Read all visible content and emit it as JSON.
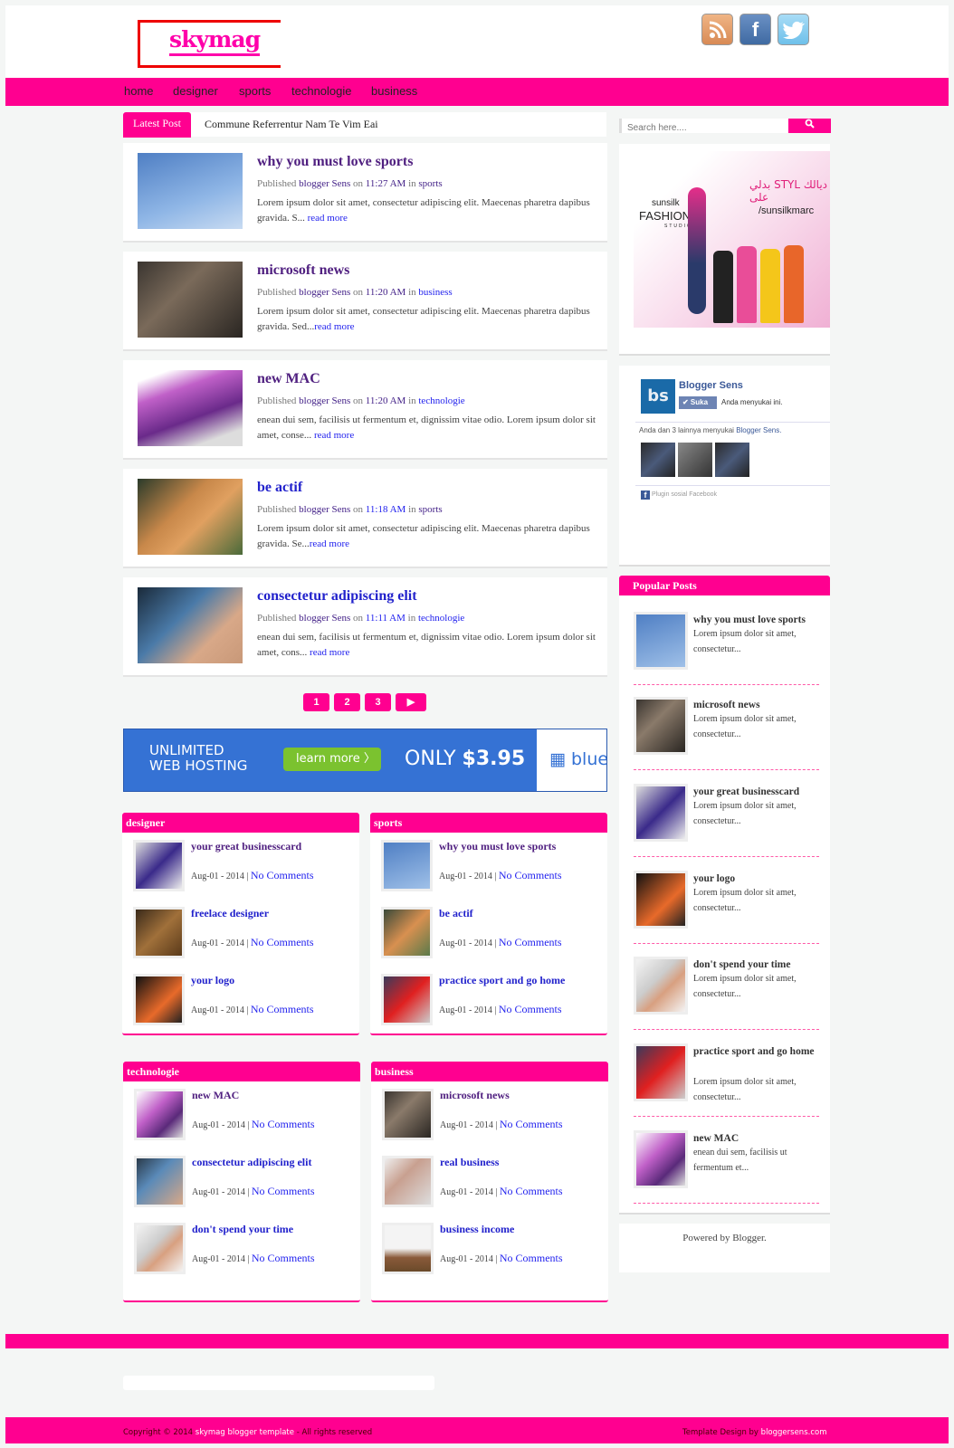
{
  "site": {
    "logo": "skymag"
  },
  "social": [
    {
      "name": "rss-icon",
      "glyph": "◉",
      "color": "#e8a06a"
    },
    {
      "name": "facebook-icon",
      "glyph": "f",
      "color": "#4a72a8"
    },
    {
      "name": "twitter-icon",
      "glyph": "🐦",
      "color": "#7cc8ee"
    }
  ],
  "nav": [
    "home",
    "designer",
    "sports",
    "technologie",
    "business"
  ],
  "latest": {
    "label": "Latest Post",
    "text": "Commune Referrentur Nam Te Vim Eai"
  },
  "search": {
    "placeholder": "Search here....",
    "button_icon": "search-icon"
  },
  "posts": [
    {
      "title": "why you must love sports",
      "published": "Published",
      "author": "blogger Sens",
      "on": "on",
      "time": "11:27 AM",
      "in": "in",
      "category": "sports",
      "excerpt": "Lorem ipsum dolor sit amet, consectetur adipiscing elit. Maecenas pharetra dapibus gravida. S...",
      "read_more": "read more"
    },
    {
      "title": "microsoft news",
      "published": "Published",
      "author": "blogger Sens",
      "on": "on",
      "time": "11:20 AM",
      "in": "in",
      "category": "business",
      "excerpt": "Lorem ipsum dolor sit amet, consectetur adipiscing elit. Maecenas pharetra dapibus gravida. Sed...",
      "read_more": "read more"
    },
    {
      "title": "new MAC",
      "published": "Published",
      "author": "blogger Sens",
      "on": "on",
      "time": "11:20 AM",
      "in": "in",
      "category": "technologie",
      "excerpt": "enean dui sem, facilisis ut fermentum et, dignissim vitae odio. Lorem ipsum dolor sit amet, conse...",
      "read_more": "read more"
    },
    {
      "title": "be actif",
      "published": "Published",
      "author": "blogger Sens",
      "on": "on",
      "time": "11:18 AM",
      "in": "in",
      "category": "sports",
      "excerpt": "Lorem ipsum dolor sit amet, consectetur adipiscing elit. Maecenas pharetra dapibus gravida. Se...",
      "read_more": "read more"
    },
    {
      "title": "consectetur adipiscing elit",
      "published": "Published",
      "author": "blogger Sens",
      "on": "on",
      "time": "11:11 AM",
      "in": "in",
      "category": "technologie",
      "excerpt": "enean dui sem, facilisis ut fermentum et, dignissim vitae odio. Lorem ipsum dolor sit amet, cons...",
      "read_more": "read more"
    }
  ],
  "pagination": [
    "1",
    "2",
    "3",
    "▶"
  ],
  "ad": {
    "line1": "UNLIMITED",
    "line2": "WEB HOSTING",
    "button": "learn more  〉",
    "price_prefix": "ONLY ",
    "price": "$3.95",
    "brand": "▦ bluehost"
  },
  "categories": [
    {
      "name": "designer",
      "items": [
        {
          "title": "your great businesscard",
          "date": "Aug-01 - 2014",
          "comments": "No Comments"
        },
        {
          "title": "freelace designer",
          "date": "Aug-01 - 2014",
          "comments": "No Comments"
        },
        {
          "title": "your logo",
          "date": "Aug-01 - 2014",
          "comments": "No Comments"
        }
      ]
    },
    {
      "name": "sports",
      "items": [
        {
          "title": "why you must love sports",
          "date": "Aug-01 - 2014",
          "comments": "No Comments"
        },
        {
          "title": "be actif",
          "date": "Aug-01 - 2014",
          "comments": "No Comments"
        },
        {
          "title": "practice sport and go home",
          "date": "Aug-01 - 2014",
          "comments": "No Comments"
        }
      ]
    },
    {
      "name": "technologie",
      "items": [
        {
          "title": "new MAC",
          "date": "Aug-01 - 2014",
          "comments": "No Comments"
        },
        {
          "title": "consectetur adipiscing elit",
          "date": "Aug-01 - 2014",
          "comments": "No Comments"
        },
        {
          "title": "don't spend your time",
          "date": "Aug-01 - 2014",
          "comments": "No Comments"
        }
      ]
    },
    {
      "name": "business",
      "items": [
        {
          "title": "microsoft news",
          "date": "Aug-01 - 2014",
          "comments": "No Comments"
        },
        {
          "title": "real business",
          "date": "Aug-01 - 2014",
          "comments": "No Comments"
        },
        {
          "title": "business income",
          "date": "Aug-01 - 2014",
          "comments": "No Comments"
        }
      ]
    }
  ],
  "sidebar_ad": {
    "brand": "sunsilk",
    "title": "FASHION",
    "sub": "STUDIO",
    "arabic": "بدلي STYL ديالك على",
    "handle": "/sunsilkmarc"
  },
  "facebook": {
    "page": "Blogger Sens",
    "avatar": "bs",
    "like": "✔ Suka",
    "liked_text": "Anda menyukai ini.",
    "count_prefix": "Anda dan 3 lainnya menyukai ",
    "count_page": "Blogger Sens.",
    "plugin": "Plugin sosial Facebook"
  },
  "popular": {
    "title": "Popular Posts",
    "items": [
      {
        "title": "why you must love sports",
        "excerpt": "Lorem ipsum dolor sit amet, consectetur..."
      },
      {
        "title": "microsoft news",
        "excerpt": "Lorem ipsum dolor sit amet, consectetur..."
      },
      {
        "title": "your great businesscard",
        "excerpt": "Lorem ipsum dolor sit amet, consectetur..."
      },
      {
        "title": "your logo",
        "excerpt": "Lorem ipsum dolor sit amet, consectetur..."
      },
      {
        "title": "don't spend your time",
        "excerpt": "Lorem ipsum dolor sit amet, consectetur..."
      },
      {
        "title": "practice sport and go home",
        "excerpt": "Lorem ipsum dolor sit amet, consectetur..."
      },
      {
        "title": "new MAC",
        "excerpt": "enean dui sem, facilisis ut fermentum et..."
      }
    ]
  },
  "powered": "Powered by Blogger.",
  "footer": {
    "copy_prefix": "Copyright © 2014 ",
    "copy_link": "skymag blogger template",
    "copy_suffix": " - All rights reserved",
    "design_prefix": "Template Design by ",
    "design_link": "bloggersens.com"
  },
  "colors": {
    "accent": "#ff0090",
    "link": "#2222ee",
    "visited": "#502080"
  }
}
